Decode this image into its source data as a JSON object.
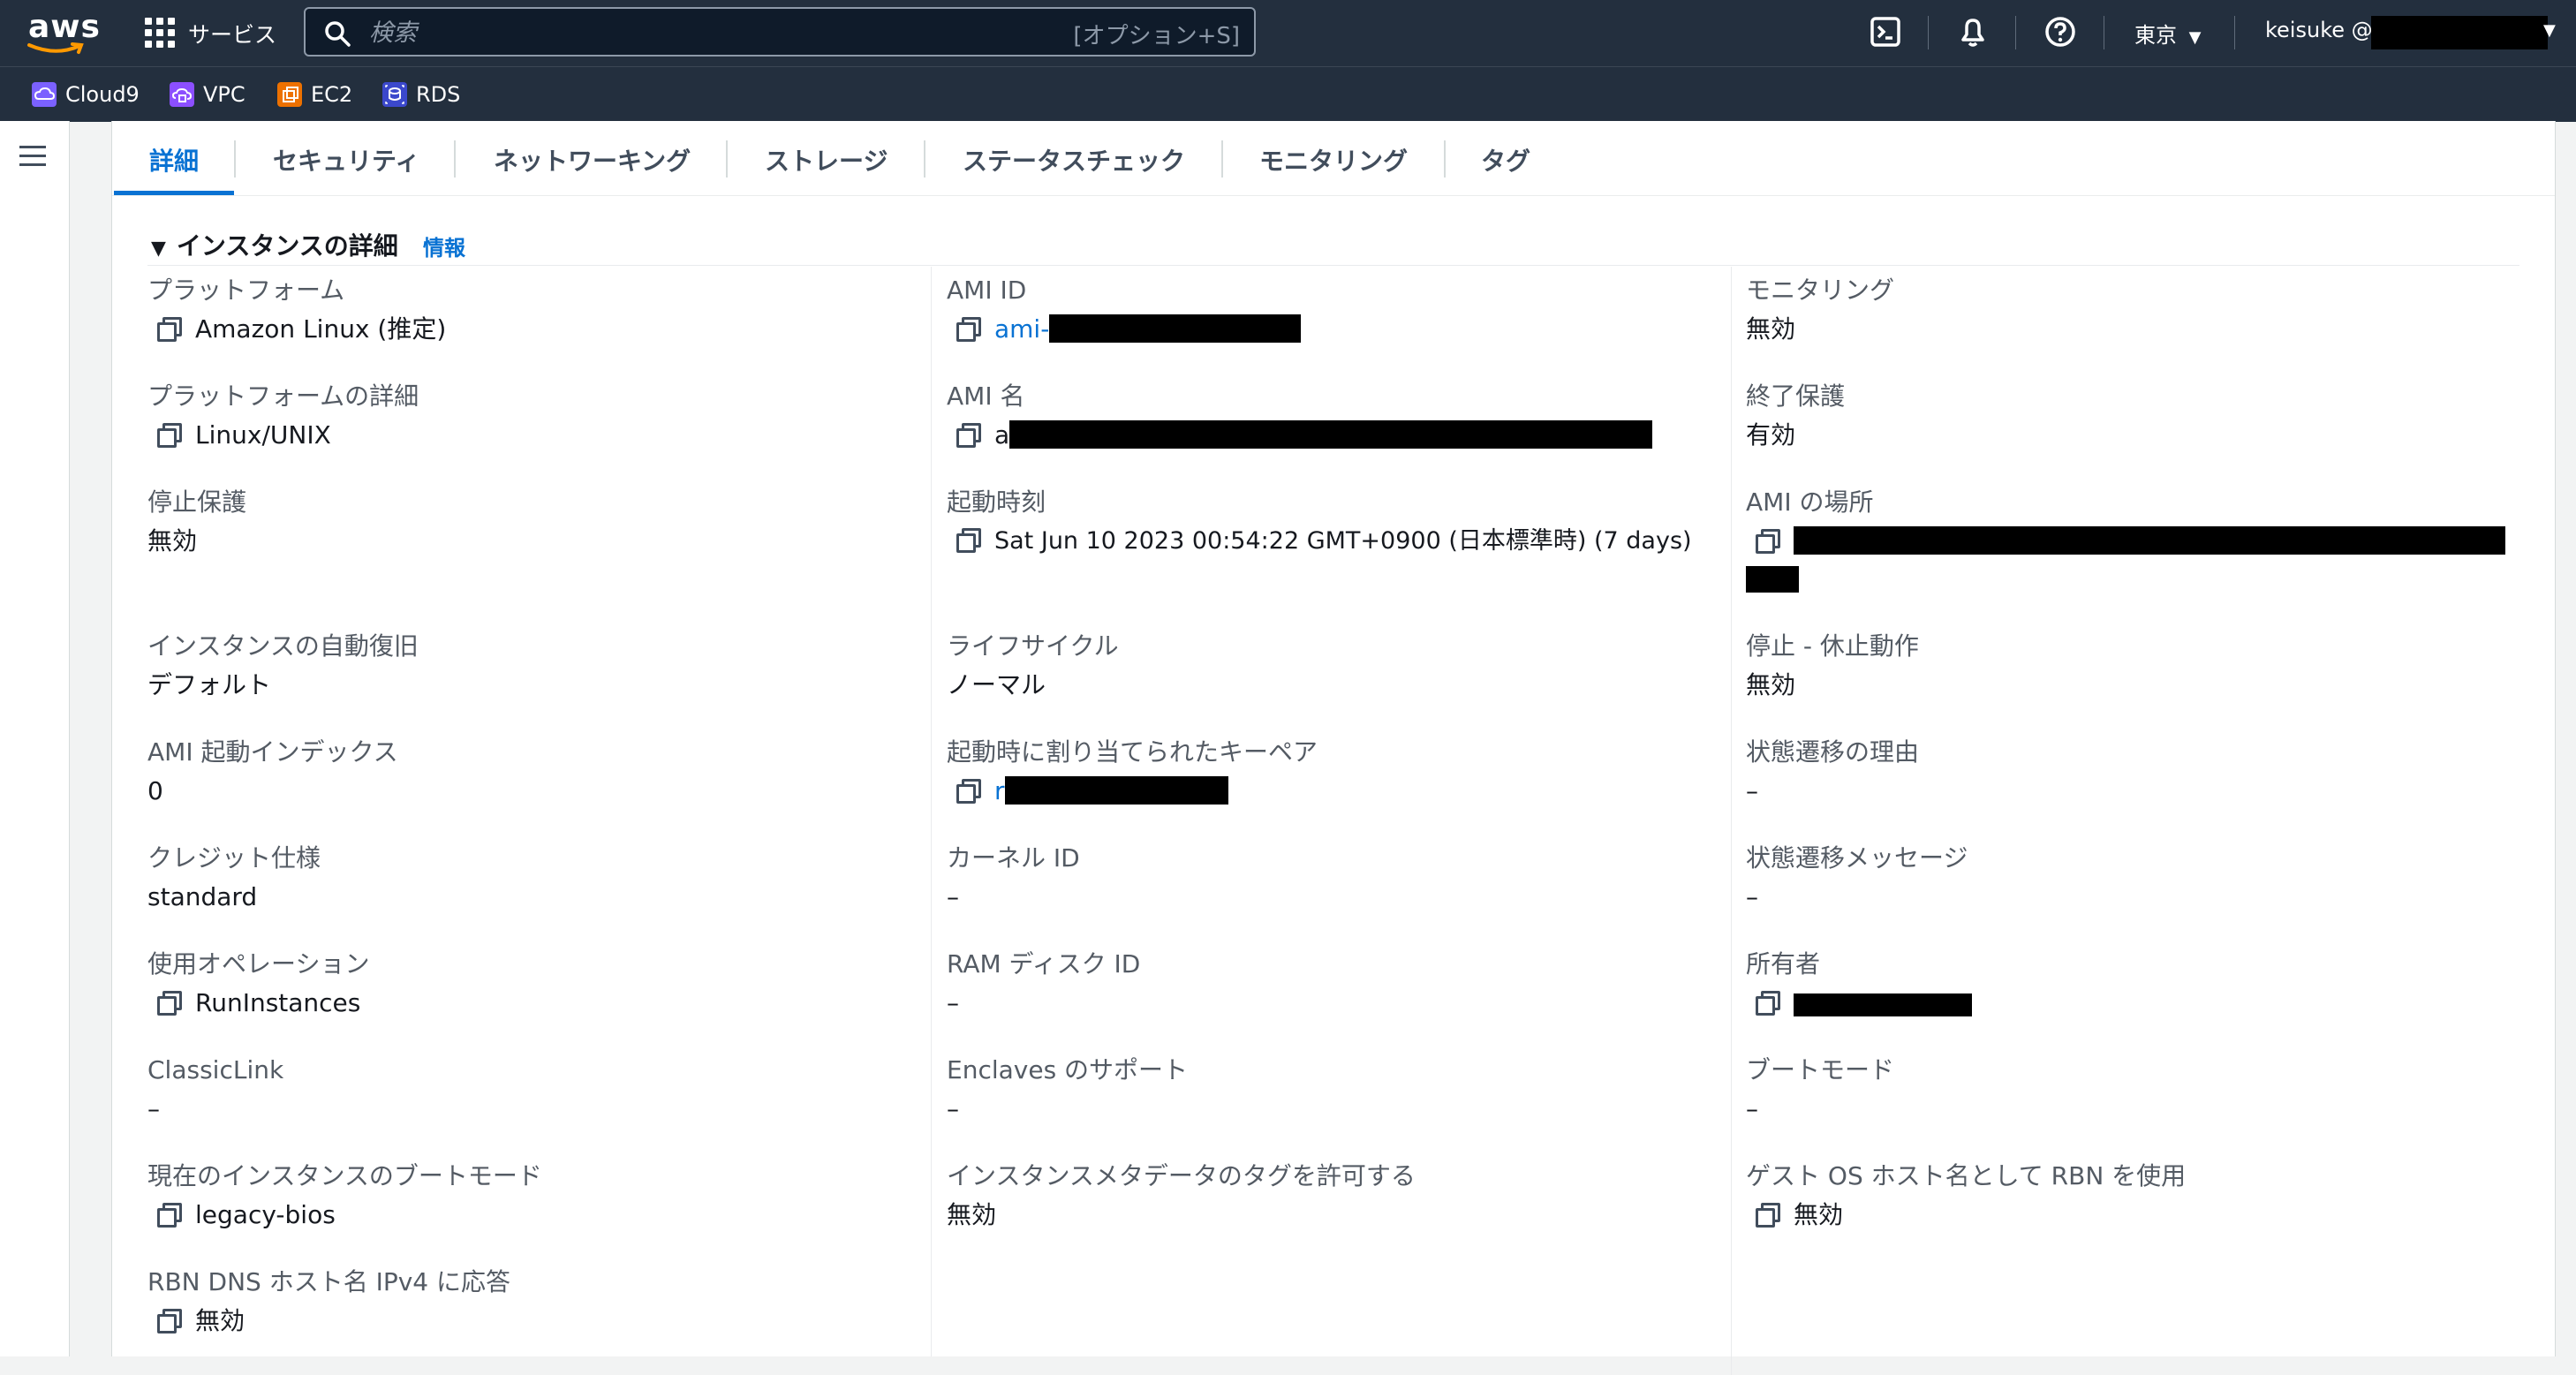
{
  "topnav": {
    "logo_text": "aws",
    "services_label": "サービス",
    "search_placeholder": "検索",
    "search_shortcut": "[オプション+S]",
    "region": "東京",
    "user_prefix": "keisuke @"
  },
  "favorites": [
    {
      "label": "Cloud9",
      "color": "#7b61ff"
    },
    {
      "label": "VPC",
      "color": "#8c4fff"
    },
    {
      "label": "EC2",
      "color": "#ed7100"
    },
    {
      "label": "RDS",
      "color": "#3b48cc"
    }
  ],
  "tabs": [
    "詳細",
    "セキュリティ",
    "ネットワーキング",
    "ストレージ",
    "ステータスチェック",
    "モニタリング",
    "タグ"
  ],
  "section": {
    "title": "インスタンスの詳細",
    "info_link": "情報"
  },
  "col1": [
    {
      "label": "プラットフォーム",
      "value": "Amazon Linux (推定)"
    },
    {
      "label": "プラットフォームの詳細",
      "value": "Linux/UNIX"
    },
    {
      "label": "停止保護",
      "value": "無効"
    },
    {
      "label": "インスタンスの自動復旧",
      "value": "デフォルト"
    },
    {
      "label": "AMI 起動インデックス",
      "value": "0"
    },
    {
      "label": "クレジット仕様",
      "value": "standard"
    },
    {
      "label": "使用オペレーション",
      "value": "RunInstances"
    },
    {
      "label": "ClassicLink",
      "value": "–"
    },
    {
      "label": "現在のインスタンスのブートモード",
      "value": "legacy-bios"
    },
    {
      "label": "RBN DNS ホスト名 IPv4 に応答",
      "value": "無効"
    }
  ],
  "col2": [
    {
      "label": "AMI ID",
      "value": "ami-"
    },
    {
      "label": "AMI 名",
      "value": "a"
    },
    {
      "label": "起動時刻",
      "value": "Sat Jun 10 2023 00:54:22 GMT+0900 (日本標準時) (7 days)"
    },
    {
      "label": "ライフサイクル",
      "value": "ノーマル"
    },
    {
      "label": "起動時に割り当てられたキーペア",
      "value": "r"
    },
    {
      "label": "カーネル ID",
      "value": "–"
    },
    {
      "label": "RAM ディスク ID",
      "value": "–"
    },
    {
      "label": "Enclaves のサポート",
      "value": "–"
    },
    {
      "label": "インスタンスメタデータのタグを許可する",
      "value": "無効"
    }
  ],
  "col3": [
    {
      "label": "モニタリング",
      "value": "無効"
    },
    {
      "label": "終了保護",
      "value": "有効"
    },
    {
      "label": "AMI の場所",
      "value": ""
    },
    {
      "label": "停止 - 休止動作",
      "value": "無効"
    },
    {
      "label": "状態遷移の理由",
      "value": "–"
    },
    {
      "label": "状態遷移メッセージ",
      "value": "–"
    },
    {
      "label": "所有者",
      "value": ""
    },
    {
      "label": "ブートモード",
      "value": "–"
    },
    {
      "label": "ゲスト OS ホスト名として RBN を使用",
      "value": "無効"
    }
  ]
}
